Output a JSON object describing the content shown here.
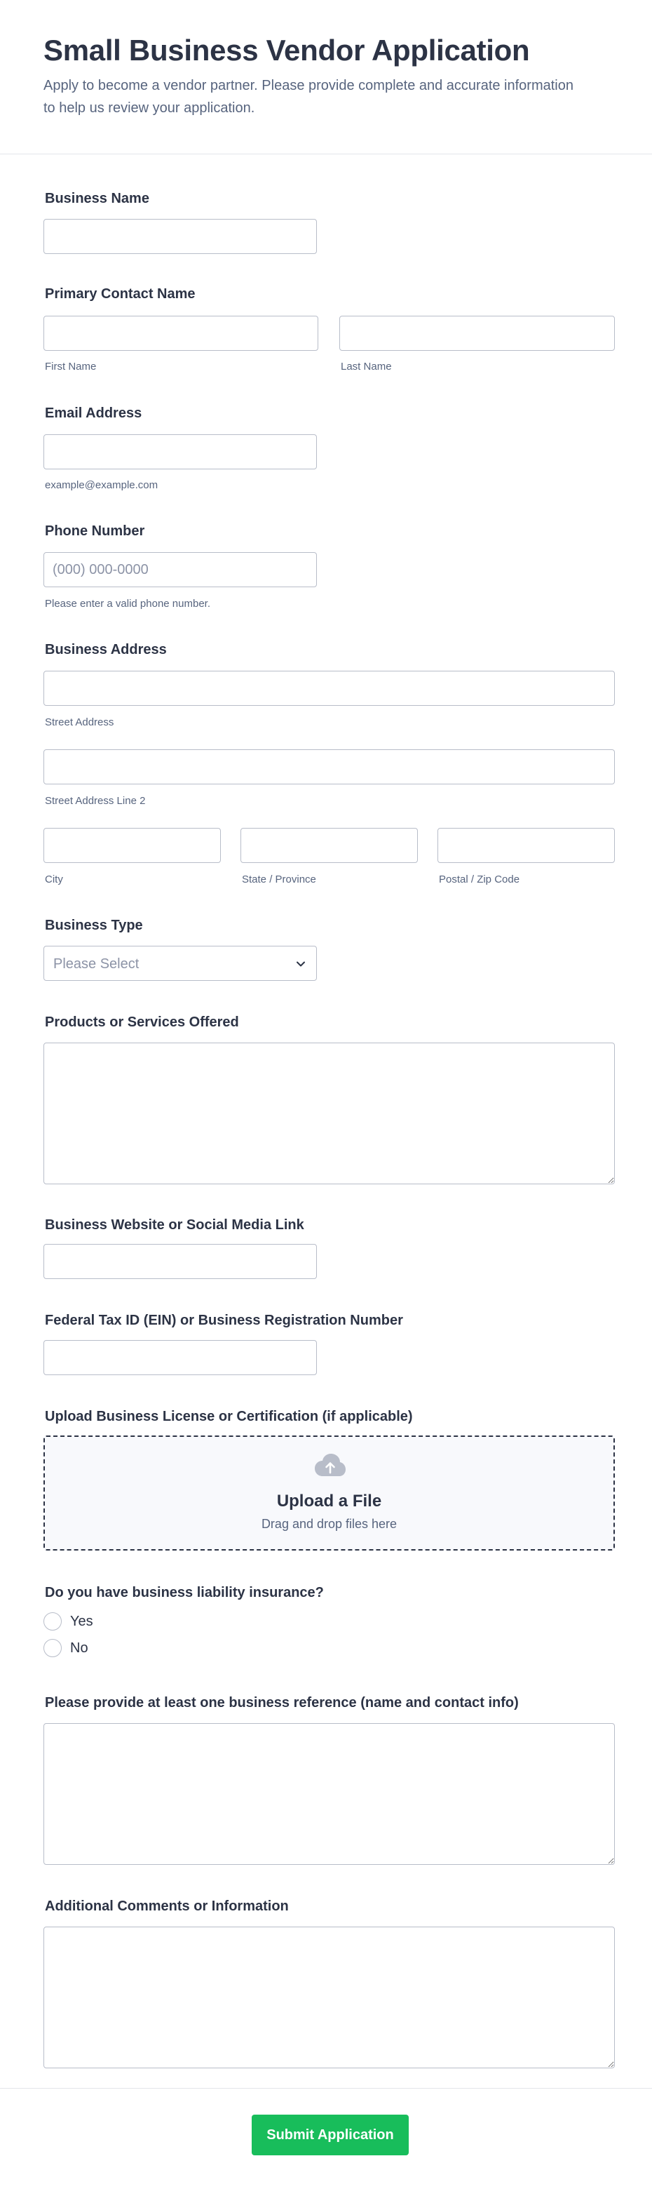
{
  "form": {
    "title": "Small Business Vendor Application",
    "subtitle": "Apply to become a vendor partner. Please provide complete and accurate information to help us review your application."
  },
  "fields": {
    "business_name": {
      "label": "Business Name",
      "value": ""
    },
    "contact_name": {
      "label": "Primary Contact Name",
      "first_sublabel": "First Name",
      "last_sublabel": "Last Name"
    },
    "email": {
      "label": "Email Address",
      "sublabel": "example@example.com"
    },
    "phone": {
      "label": "Phone Number",
      "placeholder": "(000) 000-0000",
      "sublabel": "Please enter a valid phone number."
    },
    "address": {
      "label": "Business Address",
      "street_sublabel": "Street Address",
      "street2_sublabel": "Street Address Line 2",
      "city_sublabel": "City",
      "state_sublabel": "State / Province",
      "zip_sublabel": "Postal / Zip Code"
    },
    "business_type": {
      "label": "Business Type",
      "selected": "Please Select"
    },
    "products": {
      "label": "Products or Services Offered"
    },
    "website": {
      "label": "Business Website or Social Media Link"
    },
    "tax_id": {
      "label": "Federal Tax ID (EIN) or Business Registration Number"
    },
    "upload": {
      "label": "Upload Business License or Certification (if applicable)",
      "title": "Upload a File",
      "subtitle": "Drag and drop files here",
      "icon": "cloud-upload-icon"
    },
    "insurance": {
      "label": "Do you have business liability insurance?",
      "options": [
        "Yes",
        "No"
      ]
    },
    "reference": {
      "label": "Please provide at least one business reference (name and contact info)"
    },
    "comments": {
      "label": "Additional Comments or Information"
    }
  },
  "submit": {
    "label": "Submit Application",
    "color": "#18bd5b"
  }
}
